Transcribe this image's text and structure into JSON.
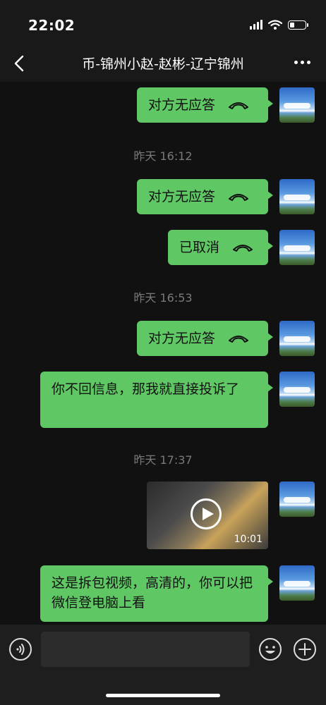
{
  "status": {
    "time": "22:02",
    "signal_bars": 4,
    "battery_fraction": 0.3
  },
  "header": {
    "title": "币-锦州小赵-赵彬-辽宁锦州",
    "back_icon": "chevron-left-icon",
    "more_icon": "more-dots-icon"
  },
  "messages": {
    "m1": {
      "type": "call",
      "text": "对方无应答",
      "icon": "call-ended-icon"
    },
    "t1": {
      "text": "昨天 16:12"
    },
    "m2": {
      "type": "call",
      "text": "对方无应答",
      "icon": "call-ended-icon"
    },
    "m3": {
      "type": "call",
      "text": "已取消",
      "icon": "call-ended-icon"
    },
    "t2": {
      "text": "昨天 16:53"
    },
    "m4": {
      "type": "call",
      "text": "对方无应答",
      "icon": "call-ended-icon"
    },
    "m5": {
      "type": "text",
      "text": "你不回信息，那我就直接投诉了"
    },
    "t3": {
      "text": "昨天 17:37"
    },
    "m6": {
      "type": "video",
      "duration": "10:01",
      "icon": "play-icon"
    },
    "m7": {
      "type": "text",
      "text": "这是拆包视频，高清的，你可以把微信登电脑上看"
    }
  },
  "inputbar": {
    "placeholder": "",
    "voice_icon": "voice-icon",
    "emoji_icon": "emoji-icon",
    "plus_icon": "plus-icon"
  }
}
